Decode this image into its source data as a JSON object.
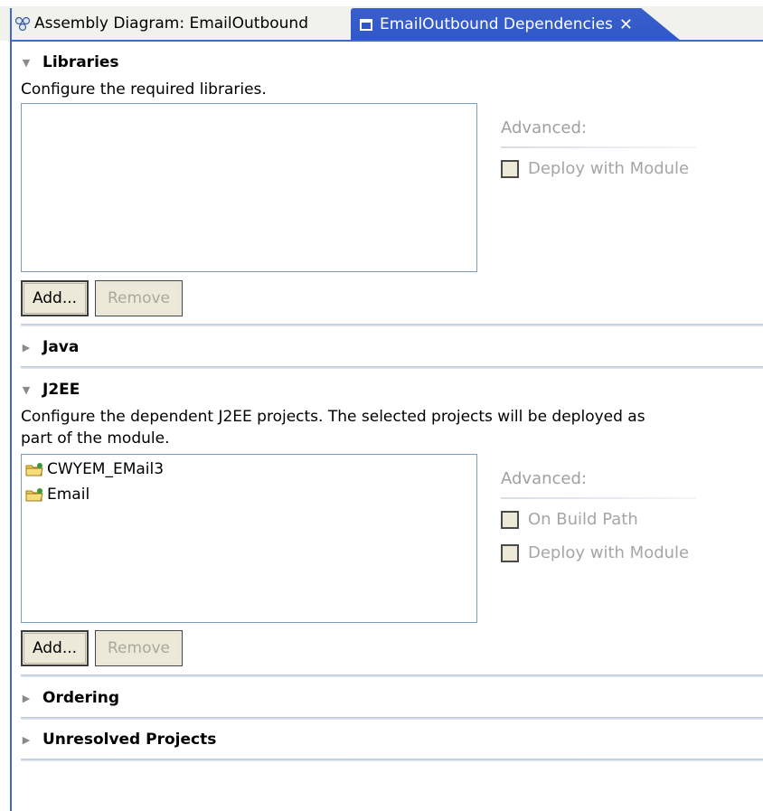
{
  "tabs": [
    {
      "label": "Assembly Diagram: EmailOutbound",
      "active": false,
      "icon": "assembly-diagram-icon"
    },
    {
      "label": "EmailOutbound Dependencies",
      "active": true,
      "icon": "editor-window-icon",
      "close": "✕"
    }
  ],
  "sections": {
    "libraries": {
      "title": "Libraries",
      "expanded": true,
      "description": "Configure the required libraries.",
      "advanced_label": "Advanced:",
      "checkboxes": [
        {
          "label": "Deploy with Module",
          "checked": false,
          "enabled": false
        }
      ],
      "add_label": "Add...",
      "remove_label": "Remove"
    },
    "java": {
      "title": "Java",
      "expanded": false
    },
    "j2ee": {
      "title": "J2EE",
      "expanded": true,
      "description_line1": "Configure the dependent J2EE projects.  The selected projects will be deployed as",
      "description_line2": "part of the module.",
      "projects": [
        "CWYEM_EMail3",
        "Email"
      ],
      "advanced_label": "Advanced:",
      "checkboxes": [
        {
          "label": "On Build Path",
          "checked": false,
          "enabled": false
        },
        {
          "label": "Deploy with Module",
          "checked": false,
          "enabled": false
        }
      ],
      "add_label": "Add...",
      "remove_label": "Remove"
    },
    "ordering": {
      "title": "Ordering",
      "expanded": false
    },
    "unresolved": {
      "title": "Unresolved Projects",
      "expanded": false
    }
  },
  "colors": {
    "active_tab": "#2f58c6",
    "disabled_text": "#a6a6a6",
    "separator": "#b9c4d9"
  }
}
